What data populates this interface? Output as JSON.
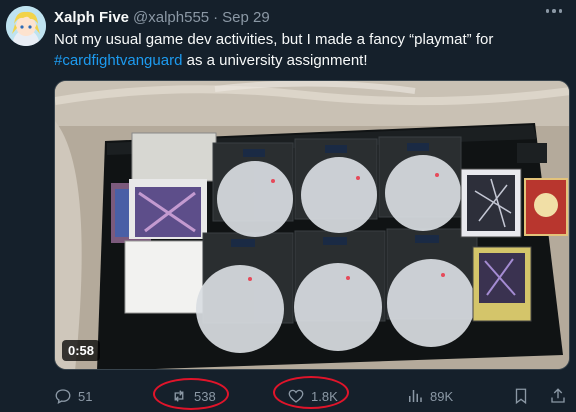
{
  "author": {
    "name": "Xalph Five",
    "handle": "@xalph555",
    "separator": "·",
    "date": "Sep 29"
  },
  "tweet": {
    "text_line1": "Not my usual game dev activities, but I made a fancy “playmat” for",
    "hashtag": "#cardfightvanguard",
    "text_line2_rest": " as a university assignment!"
  },
  "media": {
    "type": "video",
    "duration": "0:58"
  },
  "actions": {
    "replies": "51",
    "reposts": "538",
    "likes": "1.8K",
    "views": "89K"
  },
  "annotation_color": "#e0142a"
}
